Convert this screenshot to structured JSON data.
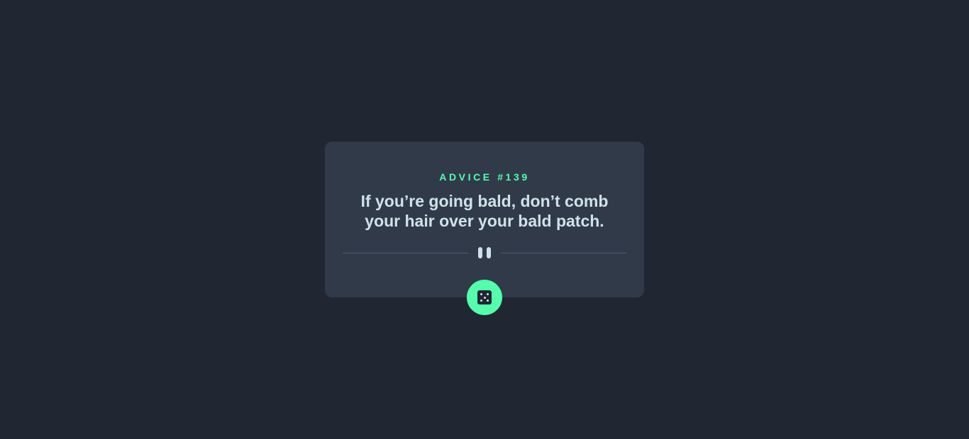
{
  "advice": {
    "id_label": "ADVICE #139",
    "text": "If you’re going bald, don’t comb your hair over your bald patch."
  },
  "icons": {
    "divider": "pause-icon",
    "button": "dice-icon"
  },
  "colors": {
    "background": "#202632",
    "card": "#313a49",
    "accent": "#53ffab",
    "text": "#cee3e9",
    "divider": "#4f5d74"
  }
}
